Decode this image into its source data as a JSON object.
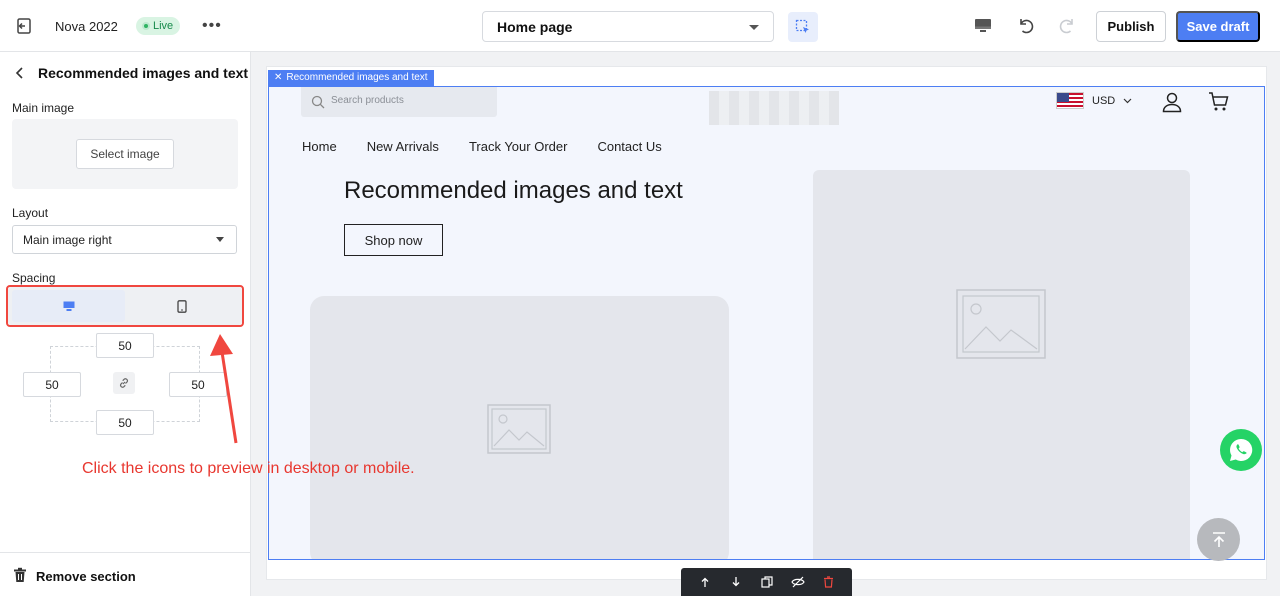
{
  "topbar": {
    "store_name": "Nova 2022",
    "status_badge": "Live",
    "more_label": "•••",
    "page_select": "Home page",
    "publish_label": "Publish",
    "save_draft_label": "Save draft"
  },
  "sidebar": {
    "title": "Recommended images and text",
    "main_image_label": "Main image",
    "select_image_label": "Select image",
    "layout_label": "Layout",
    "layout_value": "Main image right",
    "spacing_label": "Spacing",
    "spacing": {
      "top": "50",
      "left": "50",
      "right": "50",
      "bottom": "50"
    },
    "remove_label": "Remove section"
  },
  "preview": {
    "section_tag": "Recommended images and text",
    "search_placeholder": "Search products",
    "currency": "USD",
    "nav": [
      "Home",
      "New Arrivals",
      "Track Your Order",
      "Contact Us"
    ],
    "hero_title": "Recommended images and text",
    "shop_button": "Shop now"
  },
  "annotation": {
    "text": "Click the icons to preview in desktop or mobile.",
    "color": "#e8372f"
  },
  "colors": {
    "accent": "#4d7ef3",
    "live_green": "#2fb463",
    "whatsapp": "#25d366",
    "highlight": "#f0473f"
  },
  "icons": [
    "exit-icon",
    "desktop-icon",
    "mobile-icon",
    "undo-icon",
    "redo-icon",
    "select-element-icon",
    "link-icon",
    "trash-icon",
    "search-icon",
    "user-icon",
    "cart-icon",
    "image-placeholder-icon",
    "whatsapp-icon",
    "arrow-up-icon",
    "move-up-icon",
    "move-down-icon",
    "duplicate-icon",
    "hide-icon",
    "delete-icon"
  ]
}
